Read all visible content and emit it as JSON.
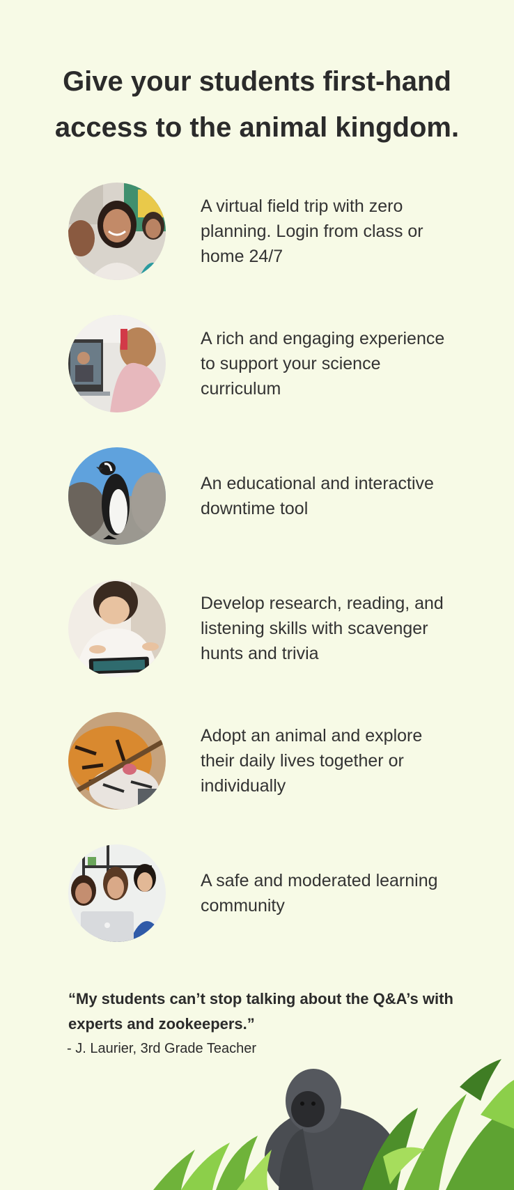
{
  "headline": "Give your students first-hand access to the animal kingdom.",
  "features": [
    {
      "text": "A virtual field trip with zero planning. Login from class or home 24/7",
      "image": "smiling-students-photo"
    },
    {
      "text": "A rich and engaging experience to support your science curriculum",
      "image": "student-laptop-video-call-photo"
    },
    {
      "text": "An educational and interactive downtime tool",
      "image": "penguin-photo"
    },
    {
      "text": "Develop research, reading, and listening skills with scavenger hunts and trivia",
      "image": "child-tablet-photo"
    },
    {
      "text": "Adopt an animal and explore their daily lives together or individually",
      "image": "tiger-cub-photo"
    },
    {
      "text": "A safe and moderated learning community",
      "image": "teacher-students-laptop-photo"
    }
  ],
  "testimonial": {
    "quote": "“My students can’t stop talking about the Q&A’s with experts and zookeepers.”",
    "attribution": "-  J. Laurier, 3rd Grade Teacher"
  },
  "colors": {
    "background": "#f7fae6",
    "text": "#2f2f2f"
  }
}
